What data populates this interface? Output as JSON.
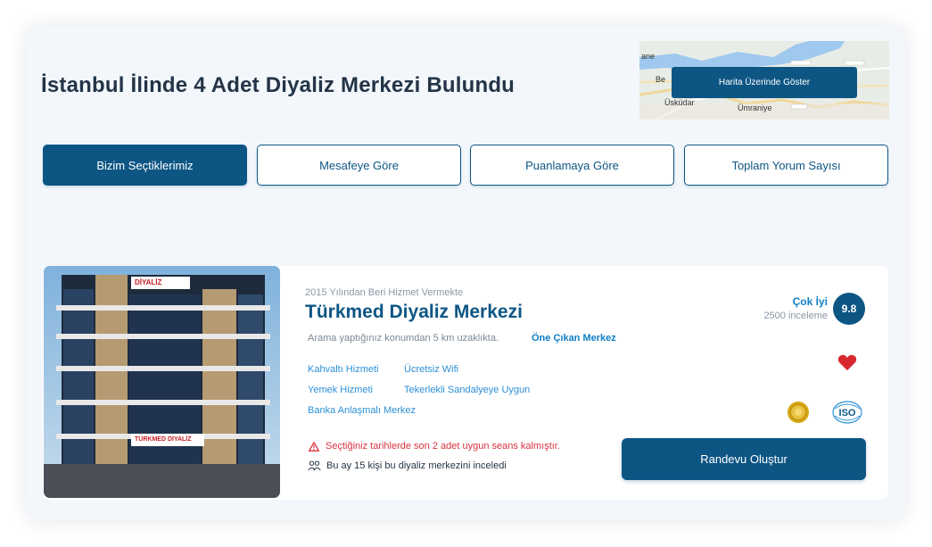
{
  "page": {
    "title": "İstanbul İlinde 4 Adet Diyaliz Merkezi Bulundu"
  },
  "map": {
    "button_label": "Harita Üzerinde Göster",
    "places": [
      "ane",
      "Be",
      "Üsküdar",
      "Ümraniye"
    ]
  },
  "tabs": [
    {
      "label": "Bizim Seçtiklerimiz",
      "active": true
    },
    {
      "label": "Mesafeye Göre",
      "active": false
    },
    {
      "label": "Puanlamaya Göre",
      "active": false
    },
    {
      "label": "Toplam Yorum Sayısı",
      "active": false
    }
  ],
  "card": {
    "photo_signs": [
      "DİYALİZ",
      "TÜRKMED DİYALİZ"
    ],
    "since": "2015 Yılından Beri Hizmet Vermekte",
    "name": "Türkmed Diyaliz Merkezi",
    "distance_text": "Arama yaptığınız konumdan 5 km uzaklıkta.",
    "featured_label": "Öne Çıkan Merkez",
    "amenities": [
      "Kahvaltı Hizmeti",
      "Ücretsiz Wifi",
      "Yemek Hizmeti",
      "Tekerlekli Sandalyeye Uygun",
      "Banka Anlaşmalı Merkez"
    ],
    "rating_word": "Çok İyi",
    "review_count": "2500 inceleme",
    "score": "9.8",
    "warning": "Seçtiğiniz tarihlerde son 2 adet uygun seans kalmıştır.",
    "viewers": "Bu ay 15 kişi bu diyaliz merkezini inceledi",
    "book_button": "Randevu Oluştur",
    "iso_label": "ISO",
    "colors": {
      "primary": "#0d5684",
      "link": "#2b8fd6",
      "warning": "#d9333f",
      "heart": "#d7282f"
    }
  }
}
